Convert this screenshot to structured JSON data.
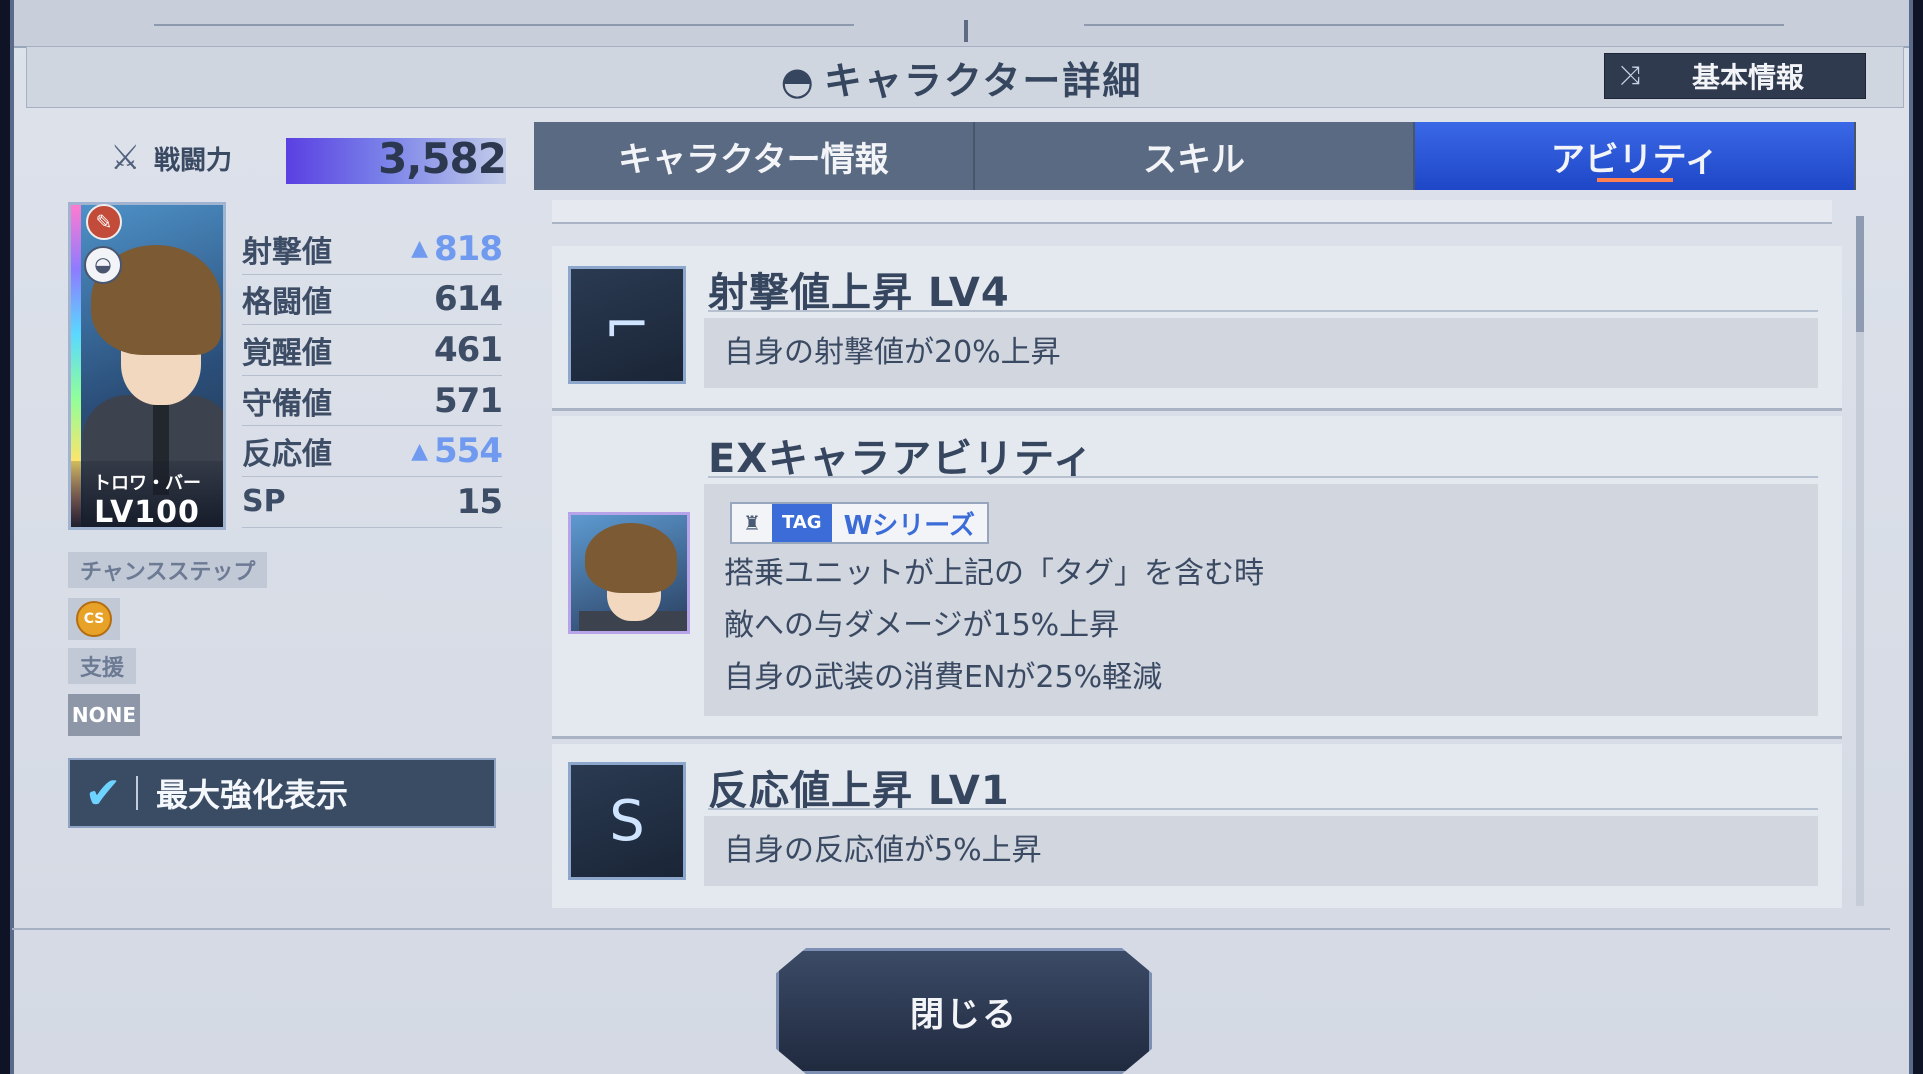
{
  "header": {
    "title": "キャラクター詳細",
    "title_icon": "helmet-icon",
    "basic_info_label": "基本情報",
    "basic_info_icon": "shuffle-icon"
  },
  "power": {
    "label": "戦闘力",
    "value": "3,582",
    "icon": "crossed-swords-icon"
  },
  "character": {
    "name": "トロワ・バートン",
    "name_shown": "トロワ・バー",
    "level": "LV100"
  },
  "stats": [
    {
      "name": "射撃値",
      "value": "818",
      "boosted": true
    },
    {
      "name": "格闘値",
      "value": "614",
      "boosted": false
    },
    {
      "name": "覚醒値",
      "value": "461",
      "boosted": false
    },
    {
      "name": "守備値",
      "value": "571",
      "boosted": false
    },
    {
      "name": "反応値",
      "value": "554",
      "boosted": true
    },
    {
      "name": "SP",
      "value": "15",
      "boosted": false
    }
  ],
  "chance_step": {
    "label": "チャンスステップ",
    "badge": "CS"
  },
  "support": {
    "label": "支援",
    "value": "NONE"
  },
  "max_button": {
    "label": "最大強化表示",
    "checked": true
  },
  "tabs": [
    {
      "label": "キャラクター情報",
      "active": false
    },
    {
      "label": "スキル",
      "active": false
    },
    {
      "label": "アビリティ",
      "active": true
    }
  ],
  "abilities": [
    {
      "name": "射撃値上昇 LV4",
      "icon": "rifle-icon",
      "desc": [
        "自身の射撃値が20%上昇"
      ]
    },
    {
      "name": "EXキャラアビリティ",
      "icon": "character-portrait",
      "tag_label": "TAG",
      "tag_value": "Wシリーズ",
      "desc": [
        "搭乗ユニットが上記の「タグ」を含む時",
        "敵への与ダメージが15%上昇",
        "自身の武装の消費ENが25%軽減"
      ]
    },
    {
      "name": "反応値上昇 LV1",
      "icon": "swoosh-icon",
      "desc": [
        "自身の反応値が5%上昇"
      ]
    }
  ],
  "close_button": {
    "label": "閉じる"
  },
  "colors": {
    "active_tab": "#2a57d8",
    "tab": "#5a6a82",
    "boost": "#6f9af0",
    "power_bar": "#5a3fe2"
  }
}
